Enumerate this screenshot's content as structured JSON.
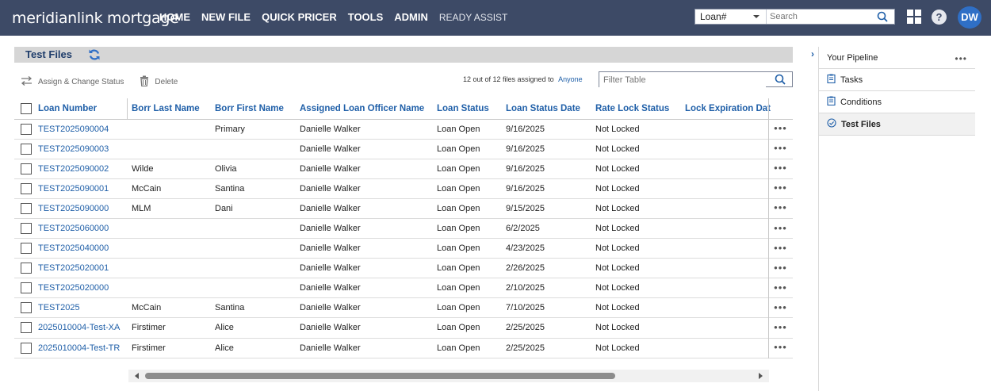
{
  "header": {
    "logo": "meridianlink mortgage",
    "nav": [
      "HOME",
      "NEW FILE",
      "QUICK PRICER",
      "TOOLS",
      "ADMIN"
    ],
    "ready_assist": "READY ASSIST",
    "search_type": "Loan#",
    "search_placeholder": "Search",
    "avatar_initials": "DW"
  },
  "page": {
    "title": "Test Files",
    "assign_label": "Assign & Change Status",
    "delete_label": "Delete",
    "count_text": "12 out of 12 files assigned to",
    "assignee_link": "Anyone",
    "filter_placeholder": "Filter Table"
  },
  "table": {
    "columns": [
      "Loan Number",
      "Borr Last Name",
      "Borr First Name",
      "Assigned Loan Officer Name",
      "Loan Status",
      "Loan Status Date",
      "Rate Lock Status",
      "Lock Expiration Dat"
    ],
    "rows": [
      [
        "TEST2025090004",
        "",
        "Primary",
        "Danielle Walker",
        "Loan Open",
        "9/16/2025",
        "Not Locked",
        ""
      ],
      [
        "TEST2025090003",
        "",
        "",
        "Danielle Walker",
        "Loan Open",
        "9/16/2025",
        "Not Locked",
        ""
      ],
      [
        "TEST2025090002",
        "Wilde",
        "Olivia",
        "Danielle Walker",
        "Loan Open",
        "9/16/2025",
        "Not Locked",
        ""
      ],
      [
        "TEST2025090001",
        "McCain",
        "Santina",
        "Danielle Walker",
        "Loan Open",
        "9/16/2025",
        "Not Locked",
        ""
      ],
      [
        "TEST2025090000",
        "MLM",
        "Dani",
        "Danielle Walker",
        "Loan Open",
        "9/15/2025",
        "Not Locked",
        ""
      ],
      [
        "TEST2025060000",
        "",
        "",
        "Danielle Walker",
        "Loan Open",
        "6/2/2025",
        "Not Locked",
        ""
      ],
      [
        "TEST2025040000",
        "",
        "",
        "Danielle Walker",
        "Loan Open",
        "4/23/2025",
        "Not Locked",
        ""
      ],
      [
        "TEST2025020001",
        "",
        "",
        "Danielle Walker",
        "Loan Open",
        "2/26/2025",
        "Not Locked",
        ""
      ],
      [
        "TEST2025020000",
        "",
        "",
        "Danielle Walker",
        "Loan Open",
        "2/10/2025",
        "Not Locked",
        ""
      ],
      [
        "TEST2025",
        "McCain",
        "Santina",
        "Danielle Walker",
        "Loan Open",
        "7/10/2025",
        "Not Locked",
        ""
      ],
      [
        "2025010004-Test-XA",
        "Firstimer",
        "Alice",
        "Danielle Walker",
        "Loan Open",
        "2/25/2025",
        "Not Locked",
        ""
      ],
      [
        "2025010004-Test-TR",
        "Firstimer",
        "Alice",
        "Danielle Walker",
        "Loan Open",
        "2/25/2025",
        "Not Locked",
        ""
      ]
    ]
  },
  "sidebar": {
    "items": [
      {
        "label": "Your Pipeline",
        "icon": "none"
      },
      {
        "label": "Tasks",
        "icon": "clipboard-icon"
      },
      {
        "label": "Conditions",
        "icon": "clipboard-icon"
      },
      {
        "label": "Test Files",
        "icon": "check-circle-icon",
        "active": true
      }
    ]
  },
  "colors": {
    "topbar": "#3d4a66",
    "link": "#1f5fa8",
    "avatar": "#2f6fc6"
  }
}
